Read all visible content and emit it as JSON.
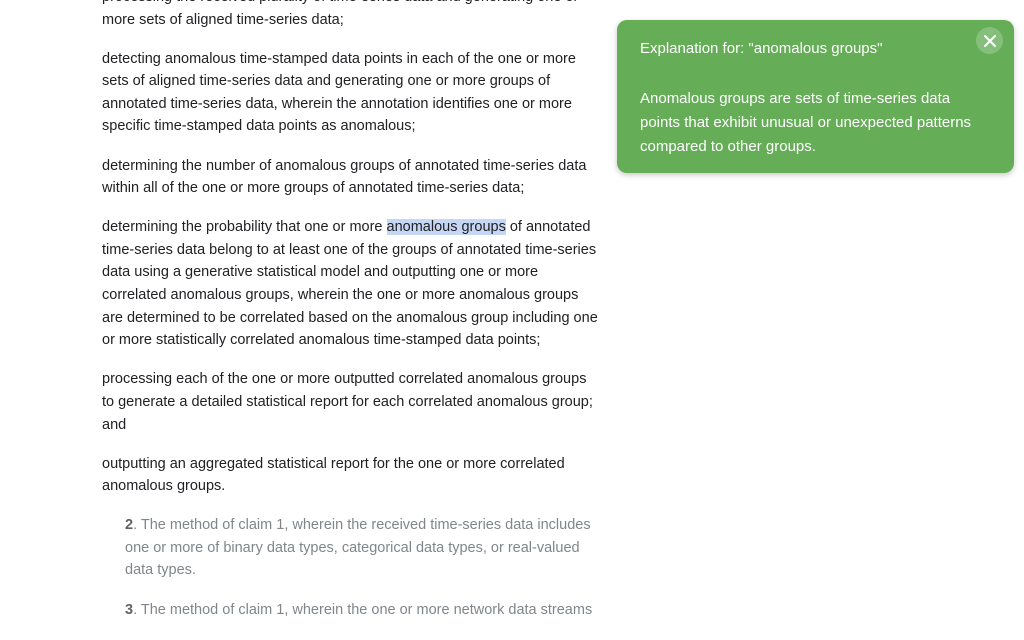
{
  "document": {
    "p0": "processing the received plurality of time-series data and generating one or more sets of aligned time-series data;",
    "p1": "detecting anomalous time-stamped data points in each of the one or more sets of aligned time-series data and generating one or more groups of annotated time-series data, wherein the annotation identifies one or more specific time-stamped data points as anomalous;",
    "p2": "determining the number of anomalous groups of annotated time-series data within all of the one or more groups of annotated time-series data;",
    "p3_before": "determining the probability that one or more ",
    "p3_highlight": "anomalous groups",
    "p3_after": " of annotated time-series data belong to at least one of the groups of annotated time-series data using a generative statistical model and outputting one or more correlated anomalous groups, wherein the one or more anomalous groups are determined to be correlated based on the anomalous group including one or more statistically correlated anomalous time-stamped data points;",
    "p4": "processing each of the one or more outputted correlated anomalous groups to generate a detailed statistical report for each correlated anomalous group; and",
    "p5": "outputting an aggregated statistical report for the one or more correlated anomalous groups.",
    "claims": [
      {
        "number": "2",
        "text": ". The method of claim 1, wherein the received time-series data includes one or more of binary data types, categorical data types, or real-valued data types."
      },
      {
        "number": "3",
        "text": ". The method of claim 1, wherein the one or more network data streams"
      }
    ]
  },
  "popup": {
    "title": "Explanation for: \"anomalous groups\"",
    "body": "Anomalous groups are sets of time-series data points that exhibit unusual or unexpected patterns compared to other groups.",
    "close_icon": "close-icon",
    "bg_color": "#65ad57"
  },
  "colors": {
    "highlight": "#c6d7f5",
    "body_text": "#202124",
    "claim_text": "#80868b"
  }
}
